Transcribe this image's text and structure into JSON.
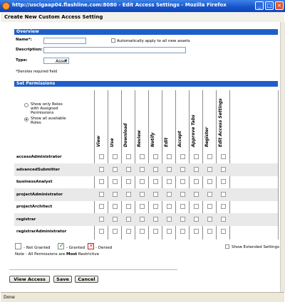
{
  "window": {
    "title": "http://usclgaap04.flashline.com:8080 - Edit Access Settings - Mozilla Firefox"
  },
  "header": {
    "title": "Create New Custom Access Setting"
  },
  "overview": {
    "section_label": "Overview",
    "name_label": "Name*:",
    "name_value": "",
    "auto_apply_label": "Automatically apply to all new assets",
    "auto_apply_checked": false,
    "description_label": "Description:",
    "description_value": "",
    "type_label": "Type:",
    "type_selected": "Asset",
    "required_note": "*Denotes required field"
  },
  "permissions": {
    "section_label": "Set Permissions",
    "filter_options": [
      {
        "label": "Show only Roles with Assigned Permissions",
        "selected": false
      },
      {
        "label": "Show all available Roles",
        "selected": true
      }
    ],
    "columns": [
      "View",
      "Use",
      "Download",
      "Review",
      "Notify",
      "Edit",
      "Accept",
      "Approve Tabs",
      "Register",
      "Edit Access Settings"
    ],
    "roles": [
      "accessAdministrator",
      "advancedSubmitter",
      "businessAnalyst",
      "projectAdministrator",
      "projectArchitect",
      "registrar",
      "registrarAdministrator"
    ]
  },
  "legend": {
    "not_granted": "- Not Granted",
    "granted": "- Granted",
    "denied": "- Denied",
    "note_prefix": "Note - All Permissions are ",
    "note_bold": "Most",
    "note_suffix": " Restrictive",
    "show_extended_label": "Show Extended Settings"
  },
  "buttons": {
    "view_access": "View Access",
    "save": "Save",
    "cancel": "Cancel"
  },
  "status": {
    "text": "Done"
  },
  "colors": {
    "section_bar": "#1e5fc9",
    "title_bar": "#1652c8"
  }
}
